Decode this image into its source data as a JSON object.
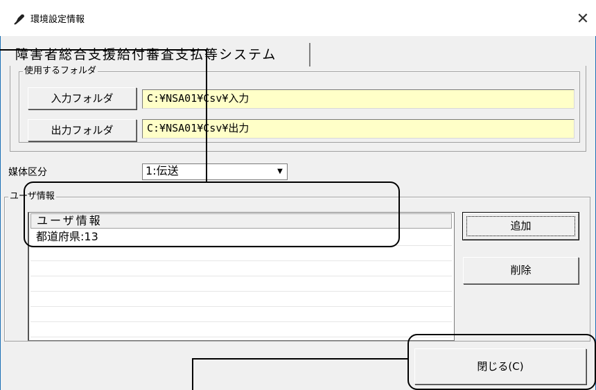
{
  "window": {
    "title": "環境設定情報",
    "close_glyph": "✕"
  },
  "tab": {
    "label": "障害者総合支援給付審査支払等システム"
  },
  "folders": {
    "group_label": "使用するフォルダ",
    "input_button": "入力フォルダ",
    "input_path": "C:¥NSA01¥Csv¥入力",
    "output_button": "出力フォルダ",
    "output_path": "C:¥NSA01¥Csv¥出力"
  },
  "media": {
    "label": "媒体区分",
    "selected": "1:伝送",
    "arrow": "▼"
  },
  "user_info": {
    "group_label": "ユーザ情報",
    "column_header": "ユーザ情報",
    "rows": [
      "都道府県:13"
    ],
    "add_button": "追加",
    "delete_button": "削除"
  },
  "footer": {
    "close_button": "閉じる(C)"
  }
}
